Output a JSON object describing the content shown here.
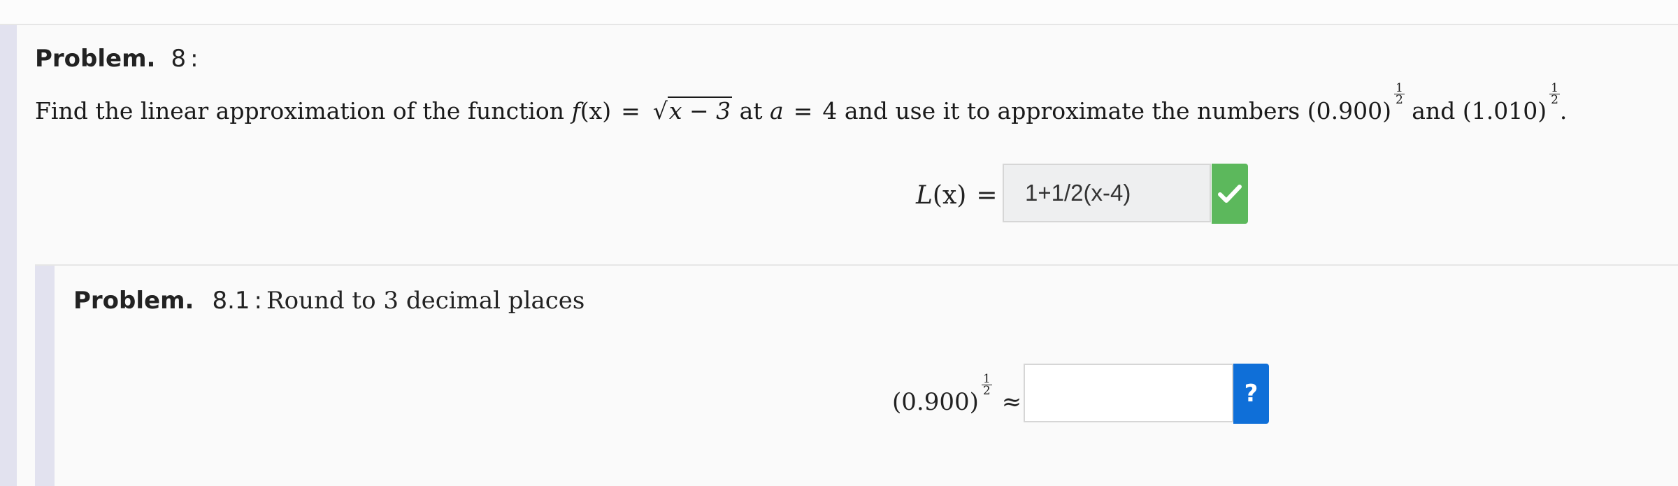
{
  "problem": {
    "keyword": "Problem.",
    "number": "8",
    "colon": ":",
    "statement": {
      "lead": "Find the linear approximation of the function",
      "func_name": "f",
      "func_var": "(x)",
      "equals": "=",
      "sqrt_symbol": "√",
      "radicand": "x − 3",
      "at_text": "at",
      "a_var": "a",
      "a_value": "4",
      "use_text": "and use it to approximate the numbers",
      "num1": "(0.900)",
      "and_text": "and",
      "num2": "(1.010)",
      "exponent_num": "1",
      "exponent_den": "2",
      "period": "."
    },
    "linear_answer": {
      "label_func": "L",
      "label_var": "(x)",
      "equals": "=",
      "value": "1+1/2(x-4)",
      "status_icon": "checkmark-icon",
      "status_color": "#5cb85c"
    }
  },
  "subproblem": {
    "keyword": "Problem.",
    "number": "8.1",
    "colon": ":",
    "instruction": "Round to 3 decimal places",
    "expression": {
      "base": "(0.900)",
      "exponent_num": "1",
      "exponent_den": "2",
      "approx": "≈"
    },
    "answer_value": "",
    "help_label": "?",
    "help_color": "#0f6fd8"
  }
}
